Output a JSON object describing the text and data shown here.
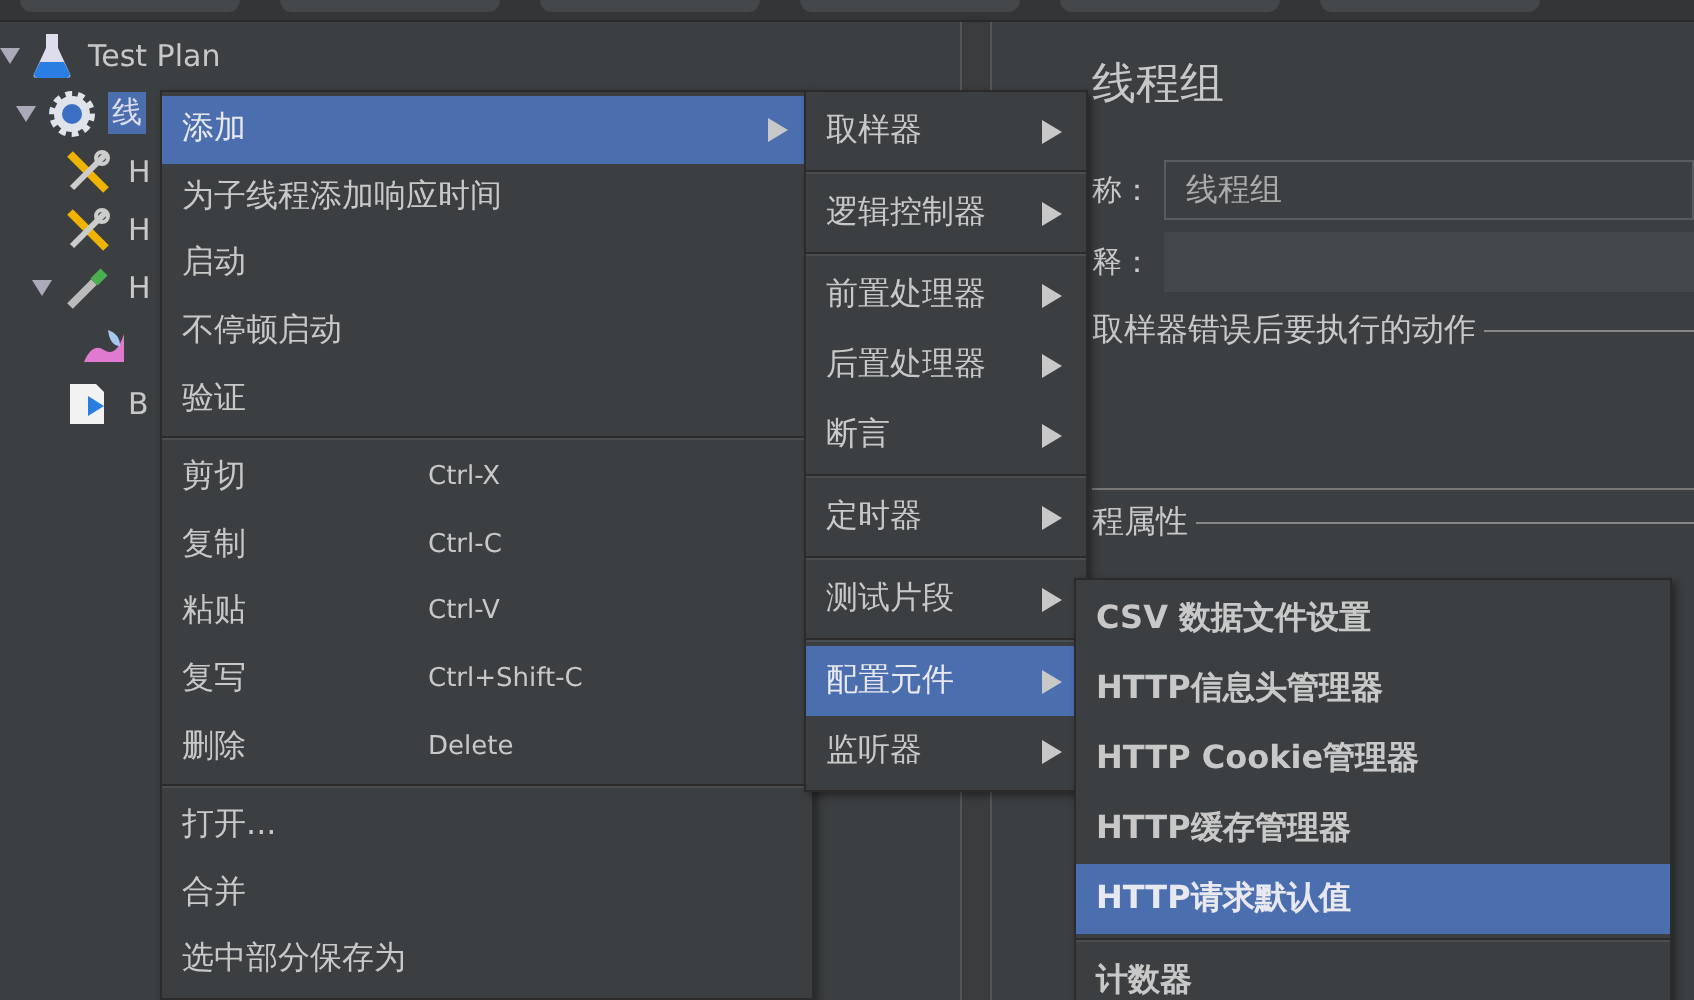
{
  "tree": {
    "items": [
      {
        "kind": "flask",
        "label": "Test Plan",
        "expanded": true,
        "selected": false,
        "children": [
          {
            "kind": "gear",
            "label": "线",
            "expanded": true,
            "selected": true,
            "children": [
              {
                "kind": "tools",
                "label": "H",
                "selected": false
              },
              {
                "kind": "tools",
                "label": "H",
                "selected": false
              },
              {
                "kind": "dropper",
                "label": "H",
                "expanded": true,
                "selected": false,
                "children": [
                  {
                    "kind": "chart"
                  }
                ]
              },
              {
                "kind": "document",
                "label": "B",
                "selected": false
              }
            ]
          }
        ]
      }
    ]
  },
  "panel": {
    "title": "线程组",
    "name_label": "称：",
    "name_value": "线程组",
    "comment_label": "释：",
    "error_action_legend": "取样器错误后要执行的动作",
    "thread_props_legend": "程属性"
  },
  "context_menu": {
    "groups": [
      [
        {
          "label": "添加",
          "submenu": true,
          "selected": true
        },
        {
          "label": "为子线程添加响应时间",
          "selected": false
        },
        {
          "label": "启动",
          "selected": false
        },
        {
          "label": "不停顿启动",
          "selected": false
        },
        {
          "label": "验证",
          "selected": false
        }
      ],
      [
        {
          "label": "剪切",
          "shortcut": "Ctrl-X",
          "selected": false
        },
        {
          "label": "复制",
          "shortcut": "Ctrl-C",
          "selected": false
        },
        {
          "label": "粘贴",
          "shortcut": "Ctrl-V",
          "selected": false
        },
        {
          "label": "复写",
          "shortcut": "Ctrl+Shift-C",
          "selected": false
        },
        {
          "label": "删除",
          "shortcut": "Delete",
          "selected": false
        }
      ],
      [
        {
          "label": "打开...",
          "selected": false
        },
        {
          "label": "合并",
          "selected": false
        },
        {
          "label": "选中部分保存为",
          "selected": false
        }
      ]
    ]
  },
  "add_submenu": {
    "groups": [
      [
        {
          "label": "取样器",
          "submenu": true,
          "selected": false
        }
      ],
      [
        {
          "label": "逻辑控制器",
          "submenu": true,
          "selected": false
        }
      ],
      [
        {
          "label": "前置处理器",
          "submenu": true,
          "selected": false
        },
        {
          "label": "后置处理器",
          "submenu": true,
          "selected": false
        },
        {
          "label": "断言",
          "submenu": true,
          "selected": false
        }
      ],
      [
        {
          "label": "定时器",
          "submenu": true,
          "selected": false
        }
      ],
      [
        {
          "label": "测试片段",
          "submenu": true,
          "selected": false
        }
      ],
      [
        {
          "label": "配置元件",
          "submenu": true,
          "selected": true
        },
        {
          "label": "监听器",
          "submenu": true,
          "selected": false
        }
      ]
    ]
  },
  "config_submenu": {
    "groups": [
      [
        {
          "label": "CSV 数据文件设置",
          "selected": false
        },
        {
          "label": "HTTP信息头管理器",
          "selected": false
        },
        {
          "label": "HTTP Cookie管理器",
          "selected": false
        },
        {
          "label": "HTTP缓存管理器",
          "selected": false
        },
        {
          "label": "HTTP请求默认值",
          "selected": true
        }
      ],
      [
        {
          "label": "计数器",
          "selected": false
        }
      ]
    ]
  }
}
